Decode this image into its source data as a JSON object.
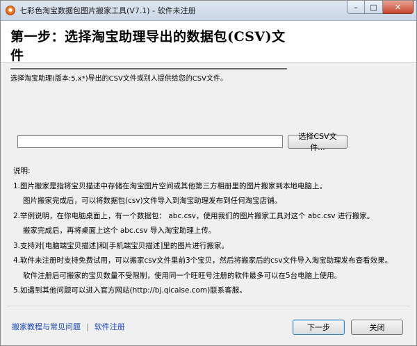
{
  "window": {
    "title": "七彩色淘宝数据包图片搬家工具(V7.1) - 软件未注册",
    "min_glyph": "–",
    "max_glyph": "□",
    "close_glyph": "✕"
  },
  "header": {
    "title": "第一步：选择淘宝助理导出的数据包(CSV)文件",
    "subtitle": "选择淘宝助理(版本:5.x*)导出的CSV文件或别人提供给您的CSV文件。"
  },
  "file_picker": {
    "value": "",
    "browse_label": "选择CSV文件..."
  },
  "notes": {
    "heading": "说明:",
    "lines": [
      {
        "text": "1.图片搬家是指将宝贝描述中存储在淘宝图片空间或其他第三方相册里的图片搬家到本地电脑上。",
        "indent": false
      },
      {
        "text": "图片搬家完成后，可以将数据包(csv)文件导入到淘宝助理发布到任何淘宝店铺。",
        "indent": true
      },
      {
        "text": "2.举例说明，在你电脑桌面上，有一个数据包： abc.csv，使用我们的图片搬家工具对这个 abc.csv 进行搬家。",
        "indent": false
      },
      {
        "text": "搬家完成后，再将桌面上这个 abc.csv 导入淘宝助理上传。",
        "indent": true
      },
      {
        "text": "3.支持对[电脑端宝贝描述]和[手机端宝贝描述]里的图片进行搬家。",
        "indent": false
      },
      {
        "text": "4.软件未注册时支持免费试用，可以搬家csv文件里前3个宝贝，然后将搬家后的csv文件导入淘宝助理发布查看效果。",
        "indent": false
      },
      {
        "text": "软件注册后可搬家的宝贝数量不受限制，使用同一个旺旺号注册的软件最多可以在5台电脑上使用。",
        "indent": true
      },
      {
        "text": "5.如遇到其他问题可以进入官方网站(http://bj.qicaise.com)联系客服。",
        "indent": false
      }
    ]
  },
  "footer": {
    "tutorial_link": "搬家教程与常见问题",
    "separator": "|",
    "register_link": "软件注册",
    "next_label": "下一步",
    "close_label": "关闭"
  }
}
